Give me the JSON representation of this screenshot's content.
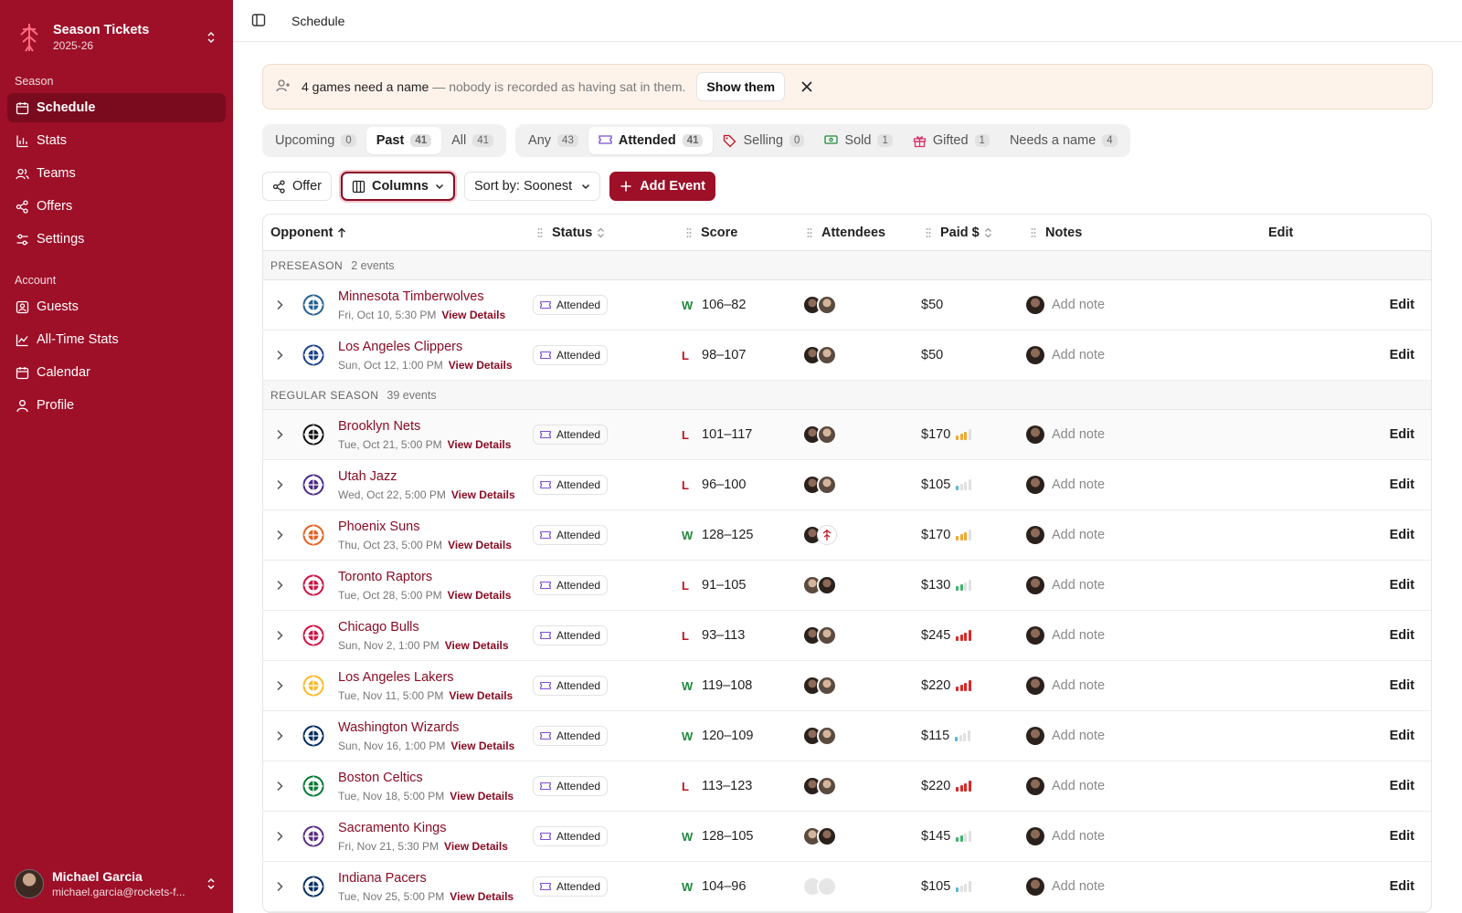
{
  "sidebar": {
    "app_title": "Season Tickets",
    "app_sub": "2025-26",
    "section_season": "Season",
    "section_account": "Account",
    "season_items": [
      {
        "label": "Schedule",
        "icon": "calendar-icon"
      },
      {
        "label": "Stats",
        "icon": "bar-chart-icon"
      },
      {
        "label": "Teams",
        "icon": "users-icon"
      },
      {
        "label": "Offers",
        "icon": "share-icon"
      },
      {
        "label": "Settings",
        "icon": "sliders-icon"
      }
    ],
    "account_items": [
      {
        "label": "Guests",
        "icon": "contact-icon"
      },
      {
        "label": "All-Time Stats",
        "icon": "line-chart-icon"
      },
      {
        "label": "Calendar",
        "icon": "calendar-icon"
      },
      {
        "label": "Profile",
        "icon": "user-icon"
      }
    ],
    "user_name": "Michael Garcia",
    "user_email": "michael.garcia@rockets-f..."
  },
  "topbar": {
    "breadcrumb": "Schedule"
  },
  "banner": {
    "bold": "4 games need a name",
    "muted": "— nobody is recorded as having sat in them.",
    "button": "Show them"
  },
  "filters": {
    "time": [
      {
        "label": "Upcoming",
        "count": "0"
      },
      {
        "label": "Past",
        "count": "41"
      },
      {
        "label": "All",
        "count": "41"
      }
    ],
    "status": [
      {
        "label": "Any",
        "count": "43"
      },
      {
        "label": "Attended",
        "count": "41"
      },
      {
        "label": "Selling",
        "count": "0"
      },
      {
        "label": "Sold",
        "count": "1"
      },
      {
        "label": "Gifted",
        "count": "1"
      },
      {
        "label": "Needs a name",
        "count": "4"
      }
    ]
  },
  "toolbar": {
    "offer": "Offer",
    "columns": "Columns",
    "sort": "Sort by: Soonest",
    "add": "Add Event"
  },
  "table": {
    "headers": {
      "opponent": "Opponent",
      "status": "Status",
      "score": "Score",
      "attendees": "Attendees",
      "paid": "Paid $",
      "notes": "Notes",
      "edit": "Edit"
    },
    "groups": [
      {
        "label": "PRESEASON",
        "count": "2 events",
        "rows": [
          {
            "team": "Minnesota Timberwolves",
            "date": "Fri, Oct 10, 5:30 PM",
            "status": "Attended",
            "result": "W",
            "score": "106–82",
            "paid": "$50",
            "bars": 0,
            "logo_color": "#236192",
            "attendees": [
              "a1",
              "a2"
            ]
          },
          {
            "team": "Los Angeles Clippers",
            "date": "Sun, Oct 12, 1:00 PM",
            "status": "Attended",
            "result": "L",
            "score": "98–107",
            "paid": "$50",
            "bars": 0,
            "logo_color": "#1d428a",
            "attendees": [
              "a1",
              "a2"
            ]
          }
        ]
      },
      {
        "label": "REGULAR SEASON",
        "count": "39 events",
        "rows": [
          {
            "team": "Brooklyn Nets",
            "date": "Tue, Oct 21, 5:00 PM",
            "status": "Attended",
            "result": "L",
            "score": "101–117",
            "paid": "$170",
            "bars": 3,
            "logo_color": "#111111",
            "attendees": [
              "a1",
              "a2"
            ]
          },
          {
            "team": "Utah Jazz",
            "date": "Wed, Oct 22, 5:00 PM",
            "status": "Attended",
            "result": "L",
            "score": "96–100",
            "paid": "$105",
            "bars": 1,
            "logo_color": "#4b2a8a",
            "attendees": [
              "a1",
              "a2"
            ]
          },
          {
            "team": "Phoenix Suns",
            "date": "Thu, Oct 23, 5:00 PM",
            "status": "Attended",
            "result": "W",
            "score": "128–125",
            "paid": "$170",
            "bars": 3,
            "logo_color": "#e56020",
            "attendees": [
              "a1",
              "rk"
            ]
          },
          {
            "team": "Toronto Raptors",
            "date": "Tue, Oct 28, 5:00 PM",
            "status": "Attended",
            "result": "L",
            "score": "91–105",
            "paid": "$130",
            "bars": 2,
            "logo_color": "#ce1141",
            "attendees": [
              "a2",
              "a1"
            ]
          },
          {
            "team": "Chicago Bulls",
            "date": "Sun, Nov 2, 1:00 PM",
            "status": "Attended",
            "result": "L",
            "score": "93–113",
            "paid": "$245",
            "bars": 4,
            "logo_color": "#ce1141",
            "attendees": [
              "a1",
              "a2"
            ]
          },
          {
            "team": "Los Angeles Lakers",
            "date": "Tue, Nov 11, 5:00 PM",
            "status": "Attended",
            "result": "W",
            "score": "119–108",
            "paid": "$220",
            "bars": 4,
            "logo_color": "#fdb927",
            "attendees": [
              "a1",
              "a2"
            ]
          },
          {
            "team": "Washington Wizards",
            "date": "Sun, Nov 16, 1:00 PM",
            "status": "Attended",
            "result": "W",
            "score": "120–109",
            "paid": "$115",
            "bars": 1,
            "logo_color": "#002b5c",
            "attendees": [
              "a1",
              "a2"
            ]
          },
          {
            "team": "Boston Celtics",
            "date": "Tue, Nov 18, 5:00 PM",
            "status": "Attended",
            "result": "L",
            "score": "113–123",
            "paid": "$220",
            "bars": 4,
            "logo_color": "#007a33",
            "attendees": [
              "a1",
              "a2"
            ]
          },
          {
            "team": "Sacramento Kings",
            "date": "Fri, Nov 21, 5:30 PM",
            "status": "Attended",
            "result": "W",
            "score": "128–105",
            "paid": "$145",
            "bars": 2,
            "logo_color": "#5a2d81",
            "attendees": [
              "a2",
              "a1"
            ]
          },
          {
            "team": "Indiana Pacers",
            "date": "Tue, Nov 25, 5:00 PM",
            "status": "Attended",
            "result": "W",
            "score": "104–96",
            "paid": "$105",
            "bars": 1,
            "logo_color": "#002d62",
            "attendees": [
              "empty",
              "empty"
            ]
          }
        ]
      }
    ],
    "view_details": "View Details",
    "add_note": "Add note",
    "edit": "Edit"
  }
}
